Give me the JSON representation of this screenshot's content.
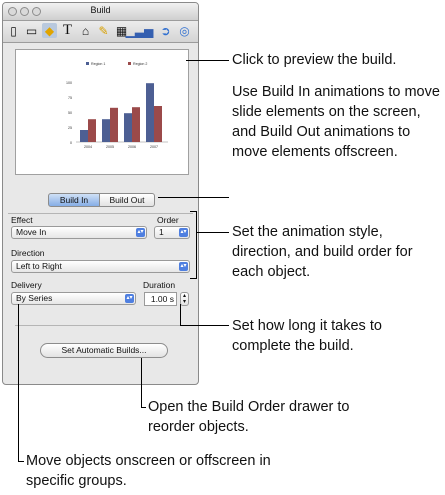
{
  "window": {
    "title": "Build",
    "toolbar_icons": [
      "document-icon",
      "layout-icon",
      "build-icon",
      "text-icon",
      "graphic-icon",
      "metrics-icon",
      "table-icon",
      "chart-icon",
      "hyperlink-icon",
      "quicktime-icon"
    ]
  },
  "preview_chart": {
    "chart_data": {
      "type": "bar",
      "categories": [
        "2004",
        "2005",
        "2006",
        "2007"
      ],
      "series": [
        {
          "name": "Region 1",
          "values": [
            20,
            38,
            48,
            98
          ],
          "color": "#4d5f93"
        },
        {
          "name": "Region 2",
          "values": [
            38,
            57,
            58,
            60
          ],
          "color": "#9b4a4a"
        }
      ],
      "yticks": [
        "0",
        "25",
        "50",
        "75",
        "100"
      ],
      "ylim": [
        0,
        100
      ]
    }
  },
  "tabs": {
    "build_in": "Build In",
    "build_out": "Build Out"
  },
  "effect": {
    "label": "Effect",
    "value": "Move In"
  },
  "order": {
    "label": "Order",
    "value": "1"
  },
  "direction": {
    "label": "Direction",
    "value": "Left to Right"
  },
  "delivery": {
    "label": "Delivery",
    "value": "By Series"
  },
  "duration": {
    "label": "Duration",
    "value": "1.00 s"
  },
  "auto_builds_button": "Set Automatic Builds...",
  "annotations": {
    "preview": "Click to preview the build.",
    "build_in_out": "Use Build In animations to move slide elements on the screen, and Build Out animations to move elements offscreen.",
    "style": "Set the animation style, direction, and build order for each object.",
    "duration": "Set how long it takes to complete the build.",
    "drawer": "Open the Build Order drawer to reorder objects.",
    "delivery": "Move objects onscreen or offscreen in specific groups."
  }
}
